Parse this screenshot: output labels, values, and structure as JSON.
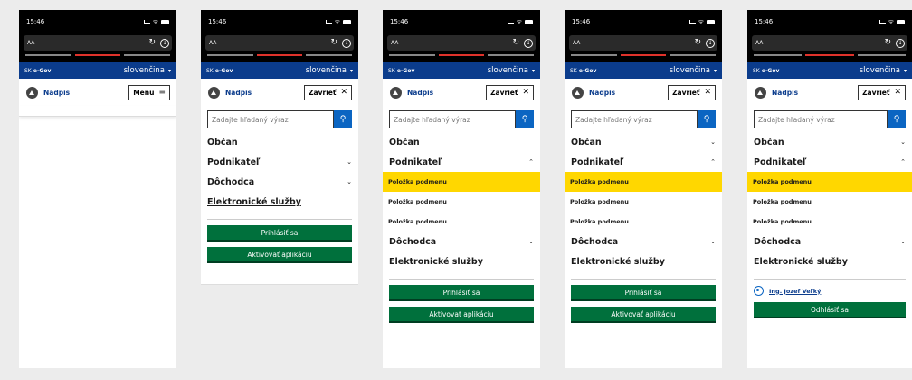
{
  "status": {
    "time": "15:46",
    "wifi_symbol": "ᯤ"
  },
  "browser": {
    "address": "AA",
    "reload_symbol": "↻",
    "download_symbol": "↓"
  },
  "gov": {
    "sk": "SK",
    "egov": "e-Gov",
    "language": "slovenčina",
    "caret": "▾"
  },
  "brand": {
    "label": "Nadpis"
  },
  "buttons": {
    "menu": "Menu",
    "menu_icon": "≡",
    "close": "Zavrieť",
    "close_icon": "✕"
  },
  "search": {
    "placeholder": "Zadajte hľadaný výraz",
    "icon": "⚲"
  },
  "nav": {
    "obcan": "Občan",
    "podnikatel": "Podnikateľ",
    "dochodca": "Dôchodca",
    "elektronicke": "Elektronické služby",
    "submenu_items": [
      "Položka podmenu",
      "Položka podmenu",
      "Položka podmenu"
    ]
  },
  "actions": {
    "login": "Prihlásiť sa",
    "activate": "Aktivovať aplikáciu",
    "logout": "Odhlásiť sa"
  },
  "user": {
    "name": "Ing. Jozef Veľký"
  },
  "icons": {
    "chevron_down": "⌄",
    "chevron_up": "⌃"
  },
  "colors": {
    "gov_blue": "#0b3c8c",
    "green": "#00703c",
    "highlight": "#ffd700",
    "search_blue": "#0b65c2"
  }
}
